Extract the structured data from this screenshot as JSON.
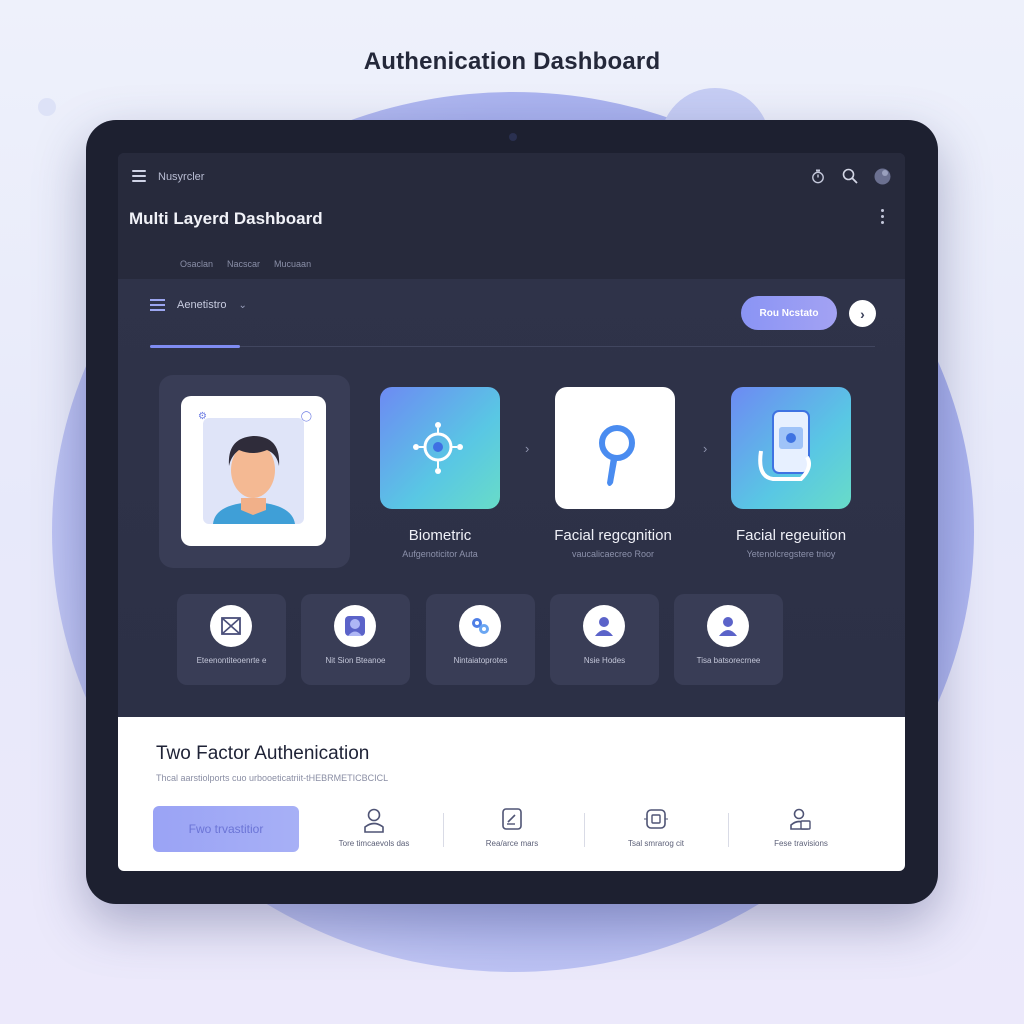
{
  "page": {
    "title": "Authenication Dashboard"
  },
  "header": {
    "brand": "Nusyrcler",
    "title": "Multi Layerd Dashboard",
    "icons": [
      "timer-icon",
      "search-icon",
      "avatar-icon",
      "kebab-menu-icon"
    ],
    "subtabs": [
      "Osaclan",
      "Nacscar",
      "Mucuaan"
    ]
  },
  "toolbar": {
    "filter_label": "Aenetistro",
    "run_button": "Rou Ncstato",
    "next_icon": "chevron-right-icon"
  },
  "methods": [
    {
      "label": "Biometric",
      "sub": "Aufgenoticitor Auta",
      "icon": "biometric-target-icon"
    },
    {
      "label": "Facial regcgnition",
      "sub": "vaucalicaecreo Roor",
      "icon": "key-icon"
    },
    {
      "label": "Facial regeuition",
      "sub": "Yetenolcregstere tnioy",
      "icon": "phone-scan-icon"
    }
  ],
  "options": [
    {
      "label": "Eteenontiteoenrte e",
      "icon": "envelope-icon"
    },
    {
      "label": "Nit Sion Bteanoe",
      "icon": "user-photo-icon"
    },
    {
      "label": "Nintaiatoprotes",
      "icon": "fingerprint-icon"
    },
    {
      "label": "Nsie Hodes",
      "icon": "user-icon"
    },
    {
      "label": "Tisa batsorecrnee",
      "icon": "user-icon"
    }
  ],
  "two_factor": {
    "title": "Two Factor Authenication",
    "subtitle": "Thcal aarstiolports cuo urbooeticatriit-tHEBRMETICBCICL",
    "button": "Fwo trvastitior",
    "options": [
      {
        "label": "Tore timcaevols das",
        "icon": "person-icon"
      },
      {
        "label": "Rea/arce mars",
        "icon": "document-edit-icon"
      },
      {
        "label": "Tsal smrarog cit",
        "icon": "chip-scan-icon"
      },
      {
        "label": "Fese travisions",
        "icon": "people-icon"
      }
    ]
  },
  "colors": {
    "accent": "#8a94f4",
    "screen_bg": "#2b2f45",
    "gradient_start": "#6d8af3",
    "gradient_end": "#68dcc8"
  }
}
